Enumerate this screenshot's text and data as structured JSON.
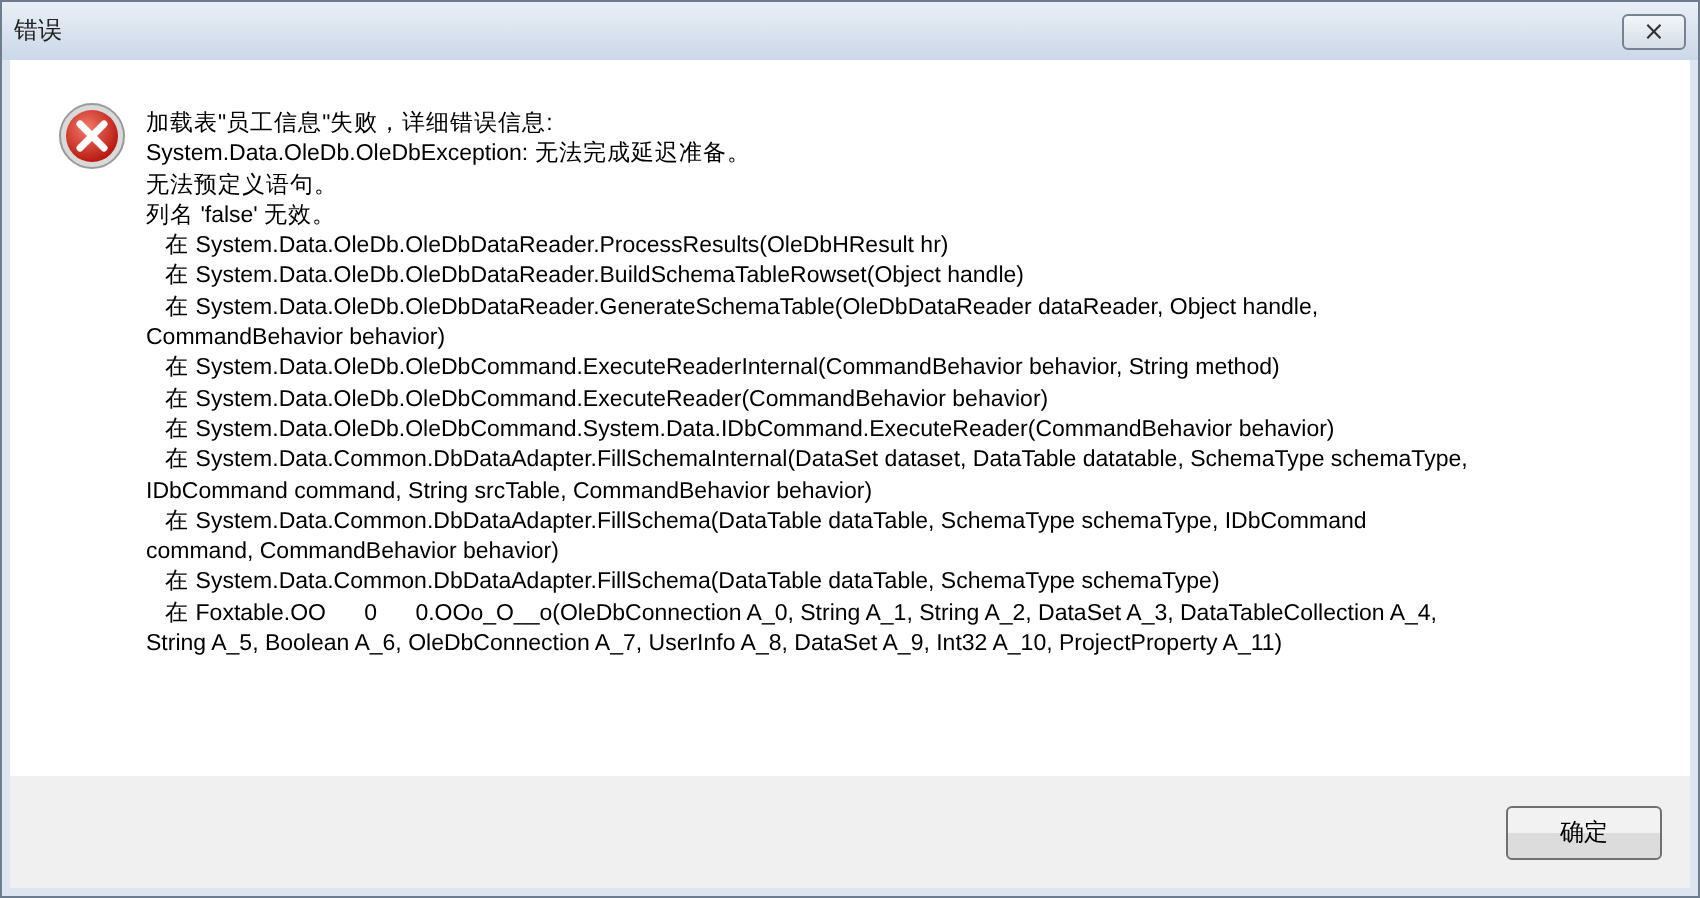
{
  "window": {
    "title": "错误",
    "close": "⨯"
  },
  "message": {
    "lines": [
      "加载表\"员工信息\"失败，详细错误信息:",
      "System.Data.OleDb.OleDbException: 无法完成延迟准备。",
      "无法预定义语句。",
      "列名 'false' 无效。",
      "   在 System.Data.OleDb.OleDbDataReader.ProcessResults(OleDbHResult hr)",
      "   在 System.Data.OleDb.OleDbDataReader.BuildSchemaTableRowset(Object handle)",
      "   在 System.Data.OleDb.OleDbDataReader.GenerateSchemaTable(OleDbDataReader dataReader, Object handle,",
      "CommandBehavior behavior)",
      "   在 System.Data.OleDb.OleDbCommand.ExecuteReaderInternal(CommandBehavior behavior, String method)",
      "   在 System.Data.OleDb.OleDbCommand.ExecuteReader(CommandBehavior behavior)",
      "   在 System.Data.OleDb.OleDbCommand.System.Data.IDbCommand.ExecuteReader(CommandBehavior behavior)",
      "   在 System.Data.Common.DbDataAdapter.FillSchemaInternal(DataSet dataset, DataTable datatable, SchemaType schemaType,",
      "IDbCommand command, String srcTable, CommandBehavior behavior)",
      "   在 System.Data.Common.DbDataAdapter.FillSchema(DataTable dataTable, SchemaType schemaType, IDbCommand",
      "command, CommandBehavior behavior)",
      "   在 System.Data.Common.DbDataAdapter.FillSchema(DataTable dataTable, SchemaType schemaType)",
      "   在 Foxtable.OO      0      0.OOo_O__o(OleDbConnection A_0, String A_1, String A_2, DataSet A_3, DataTableCollection A_4,",
      "String A_5, Boolean A_6, OleDbConnection A_7, UserInfo A_8, DataSet A_9, Int32 A_10, ProjectProperty A_11)"
    ]
  },
  "buttons": [
    "确定"
  ]
}
